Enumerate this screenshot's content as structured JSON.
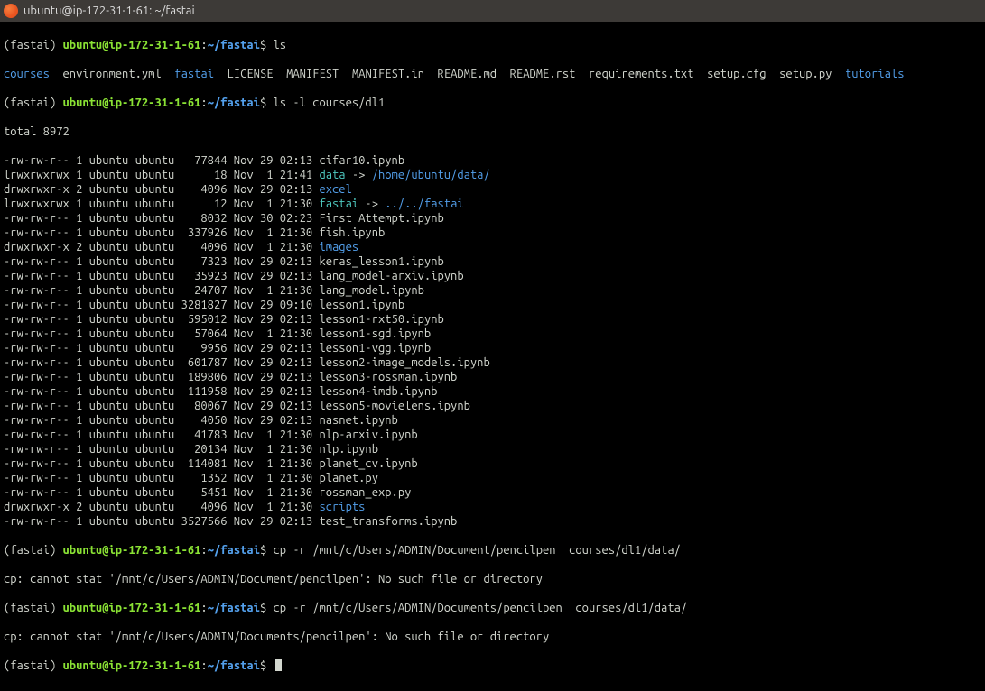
{
  "titlebar": {
    "icon_label": "ubuntu-icon",
    "title": "ubuntu@ip-172-31-1-61: ~/fastai"
  },
  "prompt": {
    "env": "(fastai)",
    "userhost": "ubuntu@ip-172-31-1-61",
    "colon": ":",
    "path": "~/fastai",
    "dollar": "$"
  },
  "cmd1": "ls",
  "ls_short": {
    "courses": "courses",
    "envyml": "environment.yml",
    "fastai": "fastai",
    "license": "LICENSE",
    "manifest": "MANIFEST",
    "manifestin": "MANIFEST.in",
    "readmemd": "README.md",
    "readmerst": "README.rst",
    "reqs": "requirements.txt",
    "setupcfg": "setup.cfg",
    "setuppy": "setup.py",
    "tutorials": "tutorials"
  },
  "cmd2": "ls -l courses/dl1",
  "total_line": "total 8972",
  "rows": [
    {
      "perm": "-rw-rw-r--",
      "links": "1",
      "owner": "ubuntu",
      "group": "ubuntu",
      "size": "77844",
      "date": "Nov 29 02:13",
      "name": "cifar10.ipynb",
      "cls": "white"
    },
    {
      "perm": "lrwxrwxrwx",
      "links": "1",
      "owner": "ubuntu",
      "group": "ubuntu",
      "size": "18",
      "date": "Nov  1 21:41",
      "name": "data",
      "cls": "cyan",
      "arrow": " -> ",
      "target": "/home/ubuntu/data/",
      "tcls": "blue"
    },
    {
      "perm": "drwxrwxr-x",
      "links": "2",
      "owner": "ubuntu",
      "group": "ubuntu",
      "size": "4096",
      "date": "Nov 29 02:13",
      "name": "excel",
      "cls": "blue"
    },
    {
      "perm": "lrwxrwxrwx",
      "links": "1",
      "owner": "ubuntu",
      "group": "ubuntu",
      "size": "12",
      "date": "Nov  1 21:30",
      "name": "fastai",
      "cls": "cyan",
      "arrow": " -> ",
      "target": "../../fastai",
      "tcls": "blue"
    },
    {
      "perm": "-rw-rw-r--",
      "links": "1",
      "owner": "ubuntu",
      "group": "ubuntu",
      "size": "8032",
      "date": "Nov 30 02:23",
      "name": "First Attempt.ipynb",
      "cls": "white"
    },
    {
      "perm": "-rw-rw-r--",
      "links": "1",
      "owner": "ubuntu",
      "group": "ubuntu",
      "size": "337926",
      "date": "Nov  1 21:30",
      "name": "fish.ipynb",
      "cls": "white"
    },
    {
      "perm": "drwxrwxr-x",
      "links": "2",
      "owner": "ubuntu",
      "group": "ubuntu",
      "size": "4096",
      "date": "Nov  1 21:30",
      "name": "images",
      "cls": "blue"
    },
    {
      "perm": "-rw-rw-r--",
      "links": "1",
      "owner": "ubuntu",
      "group": "ubuntu",
      "size": "7323",
      "date": "Nov 29 02:13",
      "name": "keras_lesson1.ipynb",
      "cls": "white"
    },
    {
      "perm": "-rw-rw-r--",
      "links": "1",
      "owner": "ubuntu",
      "group": "ubuntu",
      "size": "35923",
      "date": "Nov 29 02:13",
      "name": "lang_model-arxiv.ipynb",
      "cls": "white"
    },
    {
      "perm": "-rw-rw-r--",
      "links": "1",
      "owner": "ubuntu",
      "group": "ubuntu",
      "size": "24707",
      "date": "Nov  1 21:30",
      "name": "lang_model.ipynb",
      "cls": "white"
    },
    {
      "perm": "-rw-rw-r--",
      "links": "1",
      "owner": "ubuntu",
      "group": "ubuntu",
      "size": "3281827",
      "date": "Nov 29 09:10",
      "name": "lesson1.ipynb",
      "cls": "white"
    },
    {
      "perm": "-rw-rw-r--",
      "links": "1",
      "owner": "ubuntu",
      "group": "ubuntu",
      "size": "595012",
      "date": "Nov 29 02:13",
      "name": "lesson1-rxt50.ipynb",
      "cls": "white"
    },
    {
      "perm": "-rw-rw-r--",
      "links": "1",
      "owner": "ubuntu",
      "group": "ubuntu",
      "size": "57064",
      "date": "Nov  1 21:30",
      "name": "lesson1-sgd.ipynb",
      "cls": "white"
    },
    {
      "perm": "-rw-rw-r--",
      "links": "1",
      "owner": "ubuntu",
      "group": "ubuntu",
      "size": "9956",
      "date": "Nov 29 02:13",
      "name": "lesson1-vgg.ipynb",
      "cls": "white"
    },
    {
      "perm": "-rw-rw-r--",
      "links": "1",
      "owner": "ubuntu",
      "group": "ubuntu",
      "size": "601787",
      "date": "Nov 29 02:13",
      "name": "lesson2-image_models.ipynb",
      "cls": "white"
    },
    {
      "perm": "-rw-rw-r--",
      "links": "1",
      "owner": "ubuntu",
      "group": "ubuntu",
      "size": "189806",
      "date": "Nov 29 02:13",
      "name": "lesson3-rossman.ipynb",
      "cls": "white"
    },
    {
      "perm": "-rw-rw-r--",
      "links": "1",
      "owner": "ubuntu",
      "group": "ubuntu",
      "size": "111958",
      "date": "Nov 29 02:13",
      "name": "lesson4-imdb.ipynb",
      "cls": "white"
    },
    {
      "perm": "-rw-rw-r--",
      "links": "1",
      "owner": "ubuntu",
      "group": "ubuntu",
      "size": "80067",
      "date": "Nov 29 02:13",
      "name": "lesson5-movielens.ipynb",
      "cls": "white"
    },
    {
      "perm": "-rw-rw-r--",
      "links": "1",
      "owner": "ubuntu",
      "group": "ubuntu",
      "size": "4050",
      "date": "Nov 29 02:13",
      "name": "nasnet.ipynb",
      "cls": "white"
    },
    {
      "perm": "-rw-rw-r--",
      "links": "1",
      "owner": "ubuntu",
      "group": "ubuntu",
      "size": "41783",
      "date": "Nov  1 21:30",
      "name": "nlp-arxiv.ipynb",
      "cls": "white"
    },
    {
      "perm": "-rw-rw-r--",
      "links": "1",
      "owner": "ubuntu",
      "group": "ubuntu",
      "size": "20134",
      "date": "Nov  1 21:30",
      "name": "nlp.ipynb",
      "cls": "white"
    },
    {
      "perm": "-rw-rw-r--",
      "links": "1",
      "owner": "ubuntu",
      "group": "ubuntu",
      "size": "114081",
      "date": "Nov  1 21:30",
      "name": "planet_cv.ipynb",
      "cls": "white"
    },
    {
      "perm": "-rw-rw-r--",
      "links": "1",
      "owner": "ubuntu",
      "group": "ubuntu",
      "size": "1352",
      "date": "Nov  1 21:30",
      "name": "planet.py",
      "cls": "white"
    },
    {
      "perm": "-rw-rw-r--",
      "links": "1",
      "owner": "ubuntu",
      "group": "ubuntu",
      "size": "5451",
      "date": "Nov  1 21:30",
      "name": "rossman_exp.py",
      "cls": "white"
    },
    {
      "perm": "drwxrwxr-x",
      "links": "2",
      "owner": "ubuntu",
      "group": "ubuntu",
      "size": "4096",
      "date": "Nov  1 21:30",
      "name": "scripts",
      "cls": "blue"
    },
    {
      "perm": "-rw-rw-r--",
      "links": "1",
      "owner": "ubuntu",
      "group": "ubuntu",
      "size": "3527566",
      "date": "Nov 29 02:13",
      "name": "test_transforms.ipynb",
      "cls": "white"
    }
  ],
  "cmd3": "cp -r /mnt/c/Users/ADMIN/Document/pencilpen  courses/dl1/data/",
  "err3": "cp: cannot stat '/mnt/c/Users/ADMIN/Document/pencilpen': No such file or directory",
  "cmd4": "cp -r /mnt/c/Users/ADMIN/Documents/pencilpen  courses/dl1/data/",
  "err4": "cp: cannot stat '/mnt/c/Users/ADMIN/Documents/pencilpen': No such file or directory"
}
